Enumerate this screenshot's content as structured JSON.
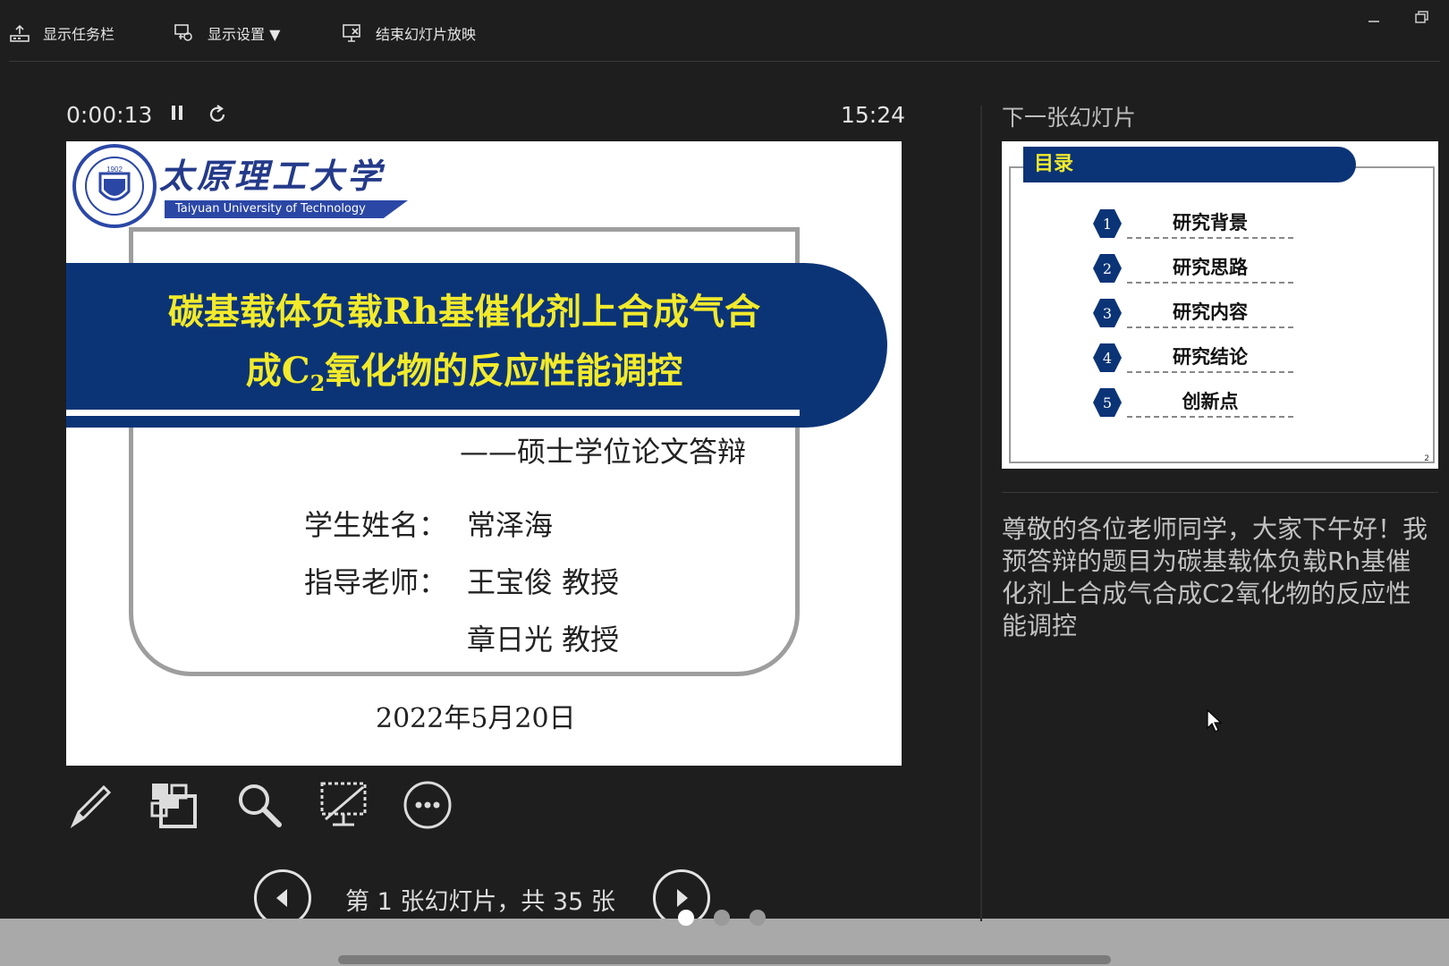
{
  "toolbar": {
    "show_taskbar": "显示任务栏",
    "display_settings": "显示设置 ▼",
    "end_slideshow": "结束幻灯片放映"
  },
  "presenter": {
    "elapsed_time": "0:00:13",
    "clock": "15:24",
    "navigation_text": "第 1 张幻灯片，共 35 张",
    "current_slide": 1,
    "total_slides": 35
  },
  "current_slide": {
    "university_cn": "太原理工大学",
    "university_en": "Taiyuan University of Technology",
    "seal_year": "1902",
    "title_line1": "碳基载体负载Rh基催化剂上合成气合",
    "title_line2_prefix": "成C",
    "title_line2_sub": "2",
    "title_line2_suffix": "氧化物的反应性能调控",
    "subtitle": "——硕士学位论文答辩",
    "student_label": "学生姓名：",
    "student_name": "常泽海",
    "advisor_label": "指导老师：",
    "advisor1": "王宝俊  教授",
    "advisor2": "章日光  教授",
    "date": "2022年5月20日"
  },
  "next_slide": {
    "label": "下一张幻灯片",
    "heading": "目录",
    "items": [
      {
        "num": "1",
        "text": "研究背景"
      },
      {
        "num": "2",
        "text": "研究思路"
      },
      {
        "num": "3",
        "text": "研究内容"
      },
      {
        "num": "4",
        "text": "研究结论"
      },
      {
        "num": "5",
        "text": "创新点"
      }
    ],
    "page_number": "2"
  },
  "notes": {
    "text": "尊敬的各位老师同学，大家下午好！我预答辩的题目为碳基载体负载Rh基催化剂上合成气合成C2氧化物的反应性能调控"
  },
  "pager_dots": {
    "count": 3,
    "active": 0
  },
  "colors": {
    "background": "#1e1e1e",
    "slide_banner": "#0b3477",
    "title_yellow": "#f2ea2b",
    "bottom_bar": "#a9a9a9"
  }
}
